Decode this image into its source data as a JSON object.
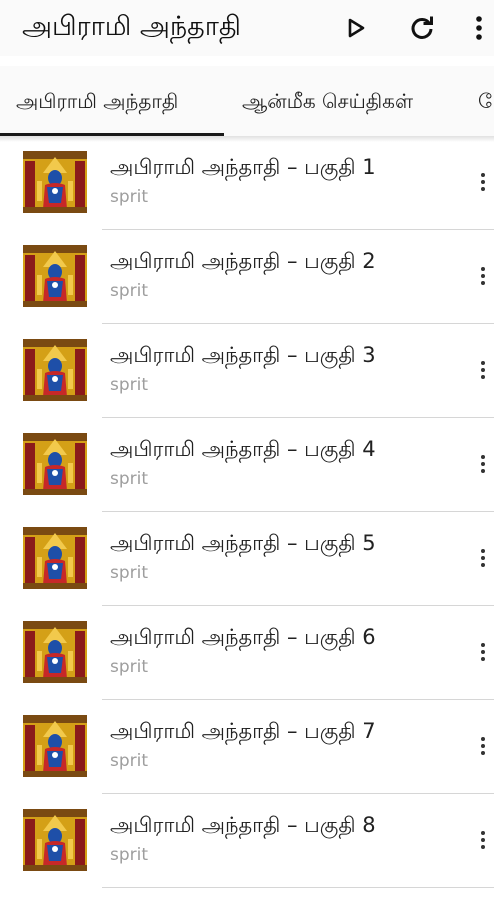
{
  "app": {
    "title": "அபிராமி அந்தாதி",
    "actions": [
      {
        "icon": "play-icon"
      },
      {
        "icon": "refresh-icon"
      },
      {
        "icon": "more-vert-icon"
      }
    ]
  },
  "tabs": [
    {
      "label": "அபிராமி அந்தாதி",
      "selected": true
    },
    {
      "label": "ஆன்மீக செய்திகள்",
      "selected": false
    },
    {
      "label": "மே",
      "selected": false
    }
  ],
  "list": {
    "items": [
      {
        "title": "அபிராமி அந்தாதி – பகுதி 1",
        "subtitle": "sprit"
      },
      {
        "title": "அபிராமி அந்தாதி – பகுதி 2",
        "subtitle": "sprit"
      },
      {
        "title": "அபிராமி அந்தாதி – பகுதி 3",
        "subtitle": "sprit"
      },
      {
        "title": "அபிராமி அந்தாதி – பகுதி 4",
        "subtitle": "sprit"
      },
      {
        "title": "அபிராமி அந்தாதி – பகுதி 5",
        "subtitle": "sprit"
      },
      {
        "title": "அபிராமி அந்தாதி – பகுதி 6",
        "subtitle": "sprit"
      },
      {
        "title": "அபிராமி அந்தாதி – பகுதி 7",
        "subtitle": "sprit"
      },
      {
        "title": "அபிராமி அந்தாதி – பகுதி 8",
        "subtitle": "sprit"
      }
    ]
  },
  "colors": {
    "accent": "#1a1a1a",
    "subtitle": "#9e9e9e",
    "divider": "#d6d6d6",
    "thumb_gold": "#d4a017",
    "thumb_red": "#c62828",
    "thumb_blue": "#1e4fa8"
  }
}
